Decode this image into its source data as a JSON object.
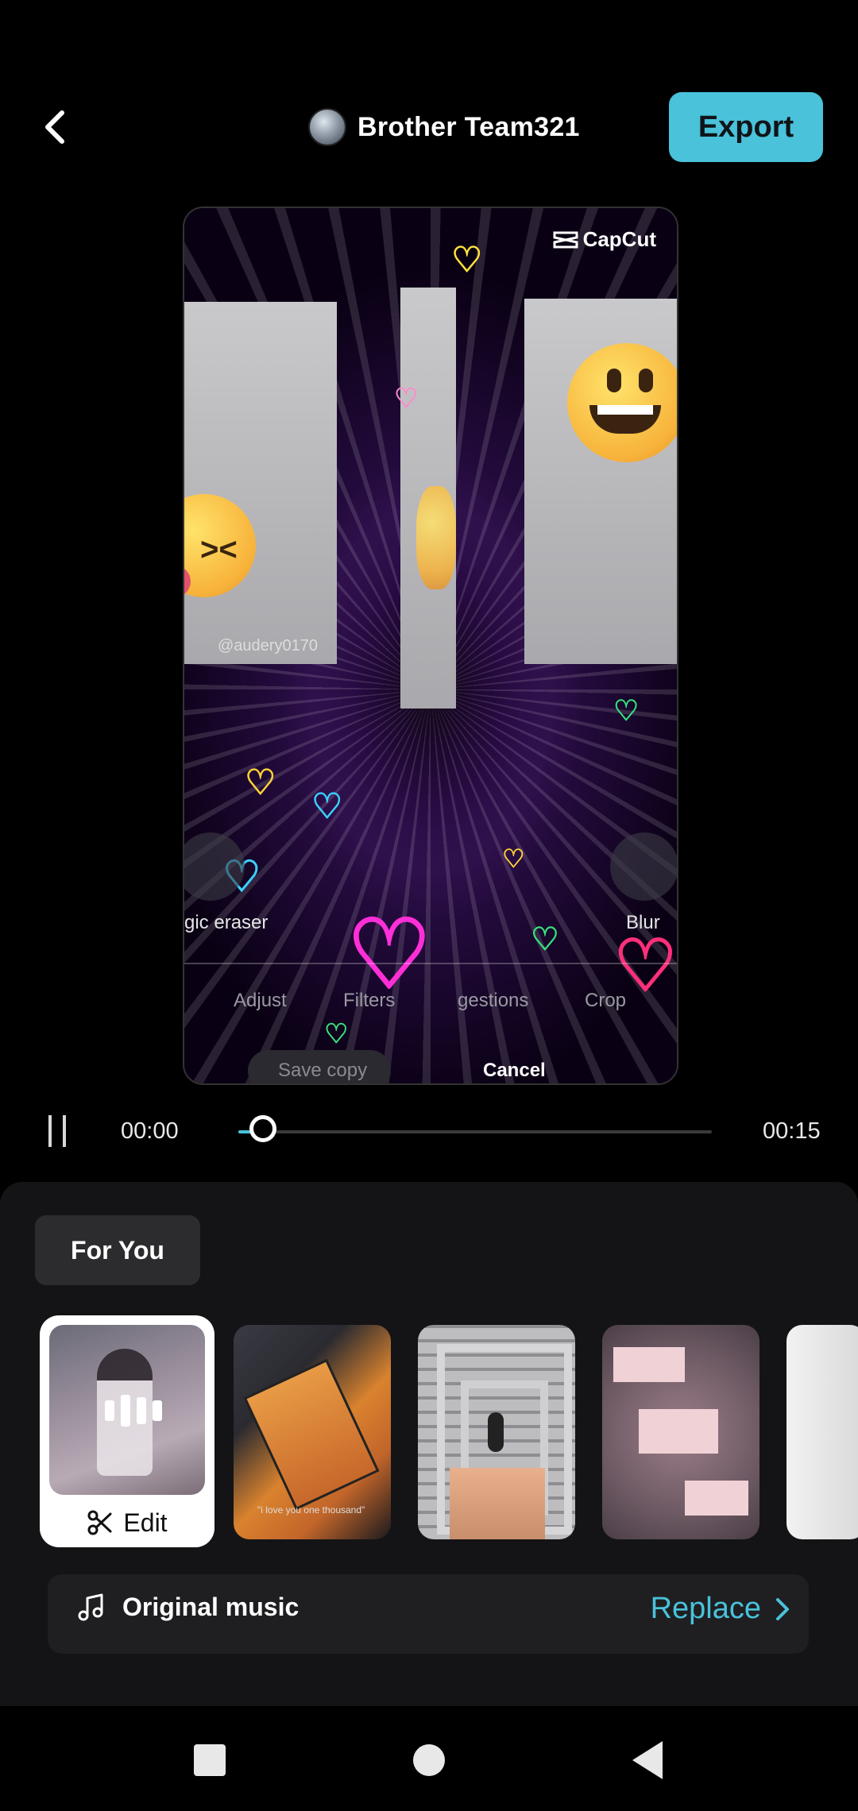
{
  "header": {
    "title": "Brother Team321",
    "export_label": "Export",
    "back_icon": "chevron-left-icon",
    "avatar_icon": "avatar"
  },
  "preview": {
    "watermark": "CapCut",
    "handle": "@audery0170",
    "tool_left_label": "gic eraser",
    "tool_right_label": "Blur",
    "bottom_tabs": [
      "Adjust",
      "Filters",
      "gestions",
      "Crop"
    ],
    "save_copy": "Save copy",
    "cancel": "Cancel"
  },
  "playback": {
    "current_time": "00:00",
    "total_time": "00:15",
    "progress": 0.04
  },
  "sheet": {
    "tab_label": "For You",
    "selected_template_action": "Edit",
    "template2_caption": "\"i love you one thousand\"",
    "music_label": "Original music",
    "replace_label": "Replace"
  },
  "colors": {
    "accent": "#49c2da",
    "sheet_bg": "#141416",
    "chip_bg": "#2c2c2e"
  }
}
